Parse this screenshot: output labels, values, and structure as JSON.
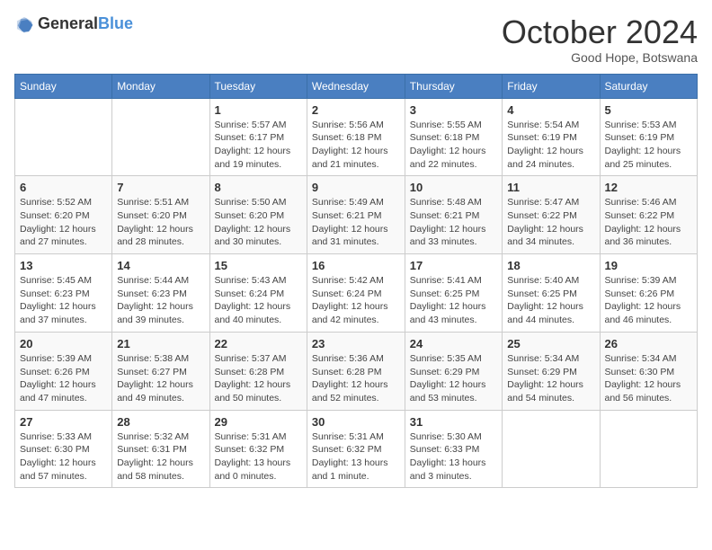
{
  "logo": {
    "text_general": "General",
    "text_blue": "Blue"
  },
  "header": {
    "month": "October 2024",
    "location": "Good Hope, Botswana"
  },
  "days_of_week": [
    "Sunday",
    "Monday",
    "Tuesday",
    "Wednesday",
    "Thursday",
    "Friday",
    "Saturday"
  ],
  "weeks": [
    [
      {
        "day": "",
        "info": ""
      },
      {
        "day": "",
        "info": ""
      },
      {
        "day": "1",
        "info": "Sunrise: 5:57 AM\nSunset: 6:17 PM\nDaylight: 12 hours and 19 minutes."
      },
      {
        "day": "2",
        "info": "Sunrise: 5:56 AM\nSunset: 6:18 PM\nDaylight: 12 hours and 21 minutes."
      },
      {
        "day": "3",
        "info": "Sunrise: 5:55 AM\nSunset: 6:18 PM\nDaylight: 12 hours and 22 minutes."
      },
      {
        "day": "4",
        "info": "Sunrise: 5:54 AM\nSunset: 6:19 PM\nDaylight: 12 hours and 24 minutes."
      },
      {
        "day": "5",
        "info": "Sunrise: 5:53 AM\nSunset: 6:19 PM\nDaylight: 12 hours and 25 minutes."
      }
    ],
    [
      {
        "day": "6",
        "info": "Sunrise: 5:52 AM\nSunset: 6:20 PM\nDaylight: 12 hours and 27 minutes."
      },
      {
        "day": "7",
        "info": "Sunrise: 5:51 AM\nSunset: 6:20 PM\nDaylight: 12 hours and 28 minutes."
      },
      {
        "day": "8",
        "info": "Sunrise: 5:50 AM\nSunset: 6:20 PM\nDaylight: 12 hours and 30 minutes."
      },
      {
        "day": "9",
        "info": "Sunrise: 5:49 AM\nSunset: 6:21 PM\nDaylight: 12 hours and 31 minutes."
      },
      {
        "day": "10",
        "info": "Sunrise: 5:48 AM\nSunset: 6:21 PM\nDaylight: 12 hours and 33 minutes."
      },
      {
        "day": "11",
        "info": "Sunrise: 5:47 AM\nSunset: 6:22 PM\nDaylight: 12 hours and 34 minutes."
      },
      {
        "day": "12",
        "info": "Sunrise: 5:46 AM\nSunset: 6:22 PM\nDaylight: 12 hours and 36 minutes."
      }
    ],
    [
      {
        "day": "13",
        "info": "Sunrise: 5:45 AM\nSunset: 6:23 PM\nDaylight: 12 hours and 37 minutes."
      },
      {
        "day": "14",
        "info": "Sunrise: 5:44 AM\nSunset: 6:23 PM\nDaylight: 12 hours and 39 minutes."
      },
      {
        "day": "15",
        "info": "Sunrise: 5:43 AM\nSunset: 6:24 PM\nDaylight: 12 hours and 40 minutes."
      },
      {
        "day": "16",
        "info": "Sunrise: 5:42 AM\nSunset: 6:24 PM\nDaylight: 12 hours and 42 minutes."
      },
      {
        "day": "17",
        "info": "Sunrise: 5:41 AM\nSunset: 6:25 PM\nDaylight: 12 hours and 43 minutes."
      },
      {
        "day": "18",
        "info": "Sunrise: 5:40 AM\nSunset: 6:25 PM\nDaylight: 12 hours and 44 minutes."
      },
      {
        "day": "19",
        "info": "Sunrise: 5:39 AM\nSunset: 6:26 PM\nDaylight: 12 hours and 46 minutes."
      }
    ],
    [
      {
        "day": "20",
        "info": "Sunrise: 5:39 AM\nSunset: 6:26 PM\nDaylight: 12 hours and 47 minutes."
      },
      {
        "day": "21",
        "info": "Sunrise: 5:38 AM\nSunset: 6:27 PM\nDaylight: 12 hours and 49 minutes."
      },
      {
        "day": "22",
        "info": "Sunrise: 5:37 AM\nSunset: 6:28 PM\nDaylight: 12 hours and 50 minutes."
      },
      {
        "day": "23",
        "info": "Sunrise: 5:36 AM\nSunset: 6:28 PM\nDaylight: 12 hours and 52 minutes."
      },
      {
        "day": "24",
        "info": "Sunrise: 5:35 AM\nSunset: 6:29 PM\nDaylight: 12 hours and 53 minutes."
      },
      {
        "day": "25",
        "info": "Sunrise: 5:34 AM\nSunset: 6:29 PM\nDaylight: 12 hours and 54 minutes."
      },
      {
        "day": "26",
        "info": "Sunrise: 5:34 AM\nSunset: 6:30 PM\nDaylight: 12 hours and 56 minutes."
      }
    ],
    [
      {
        "day": "27",
        "info": "Sunrise: 5:33 AM\nSunset: 6:30 PM\nDaylight: 12 hours and 57 minutes."
      },
      {
        "day": "28",
        "info": "Sunrise: 5:32 AM\nSunset: 6:31 PM\nDaylight: 12 hours and 58 minutes."
      },
      {
        "day": "29",
        "info": "Sunrise: 5:31 AM\nSunset: 6:32 PM\nDaylight: 13 hours and 0 minutes."
      },
      {
        "day": "30",
        "info": "Sunrise: 5:31 AM\nSunset: 6:32 PM\nDaylight: 13 hours and 1 minute."
      },
      {
        "day": "31",
        "info": "Sunrise: 5:30 AM\nSunset: 6:33 PM\nDaylight: 13 hours and 3 minutes."
      },
      {
        "day": "",
        "info": ""
      },
      {
        "day": "",
        "info": ""
      }
    ]
  ]
}
